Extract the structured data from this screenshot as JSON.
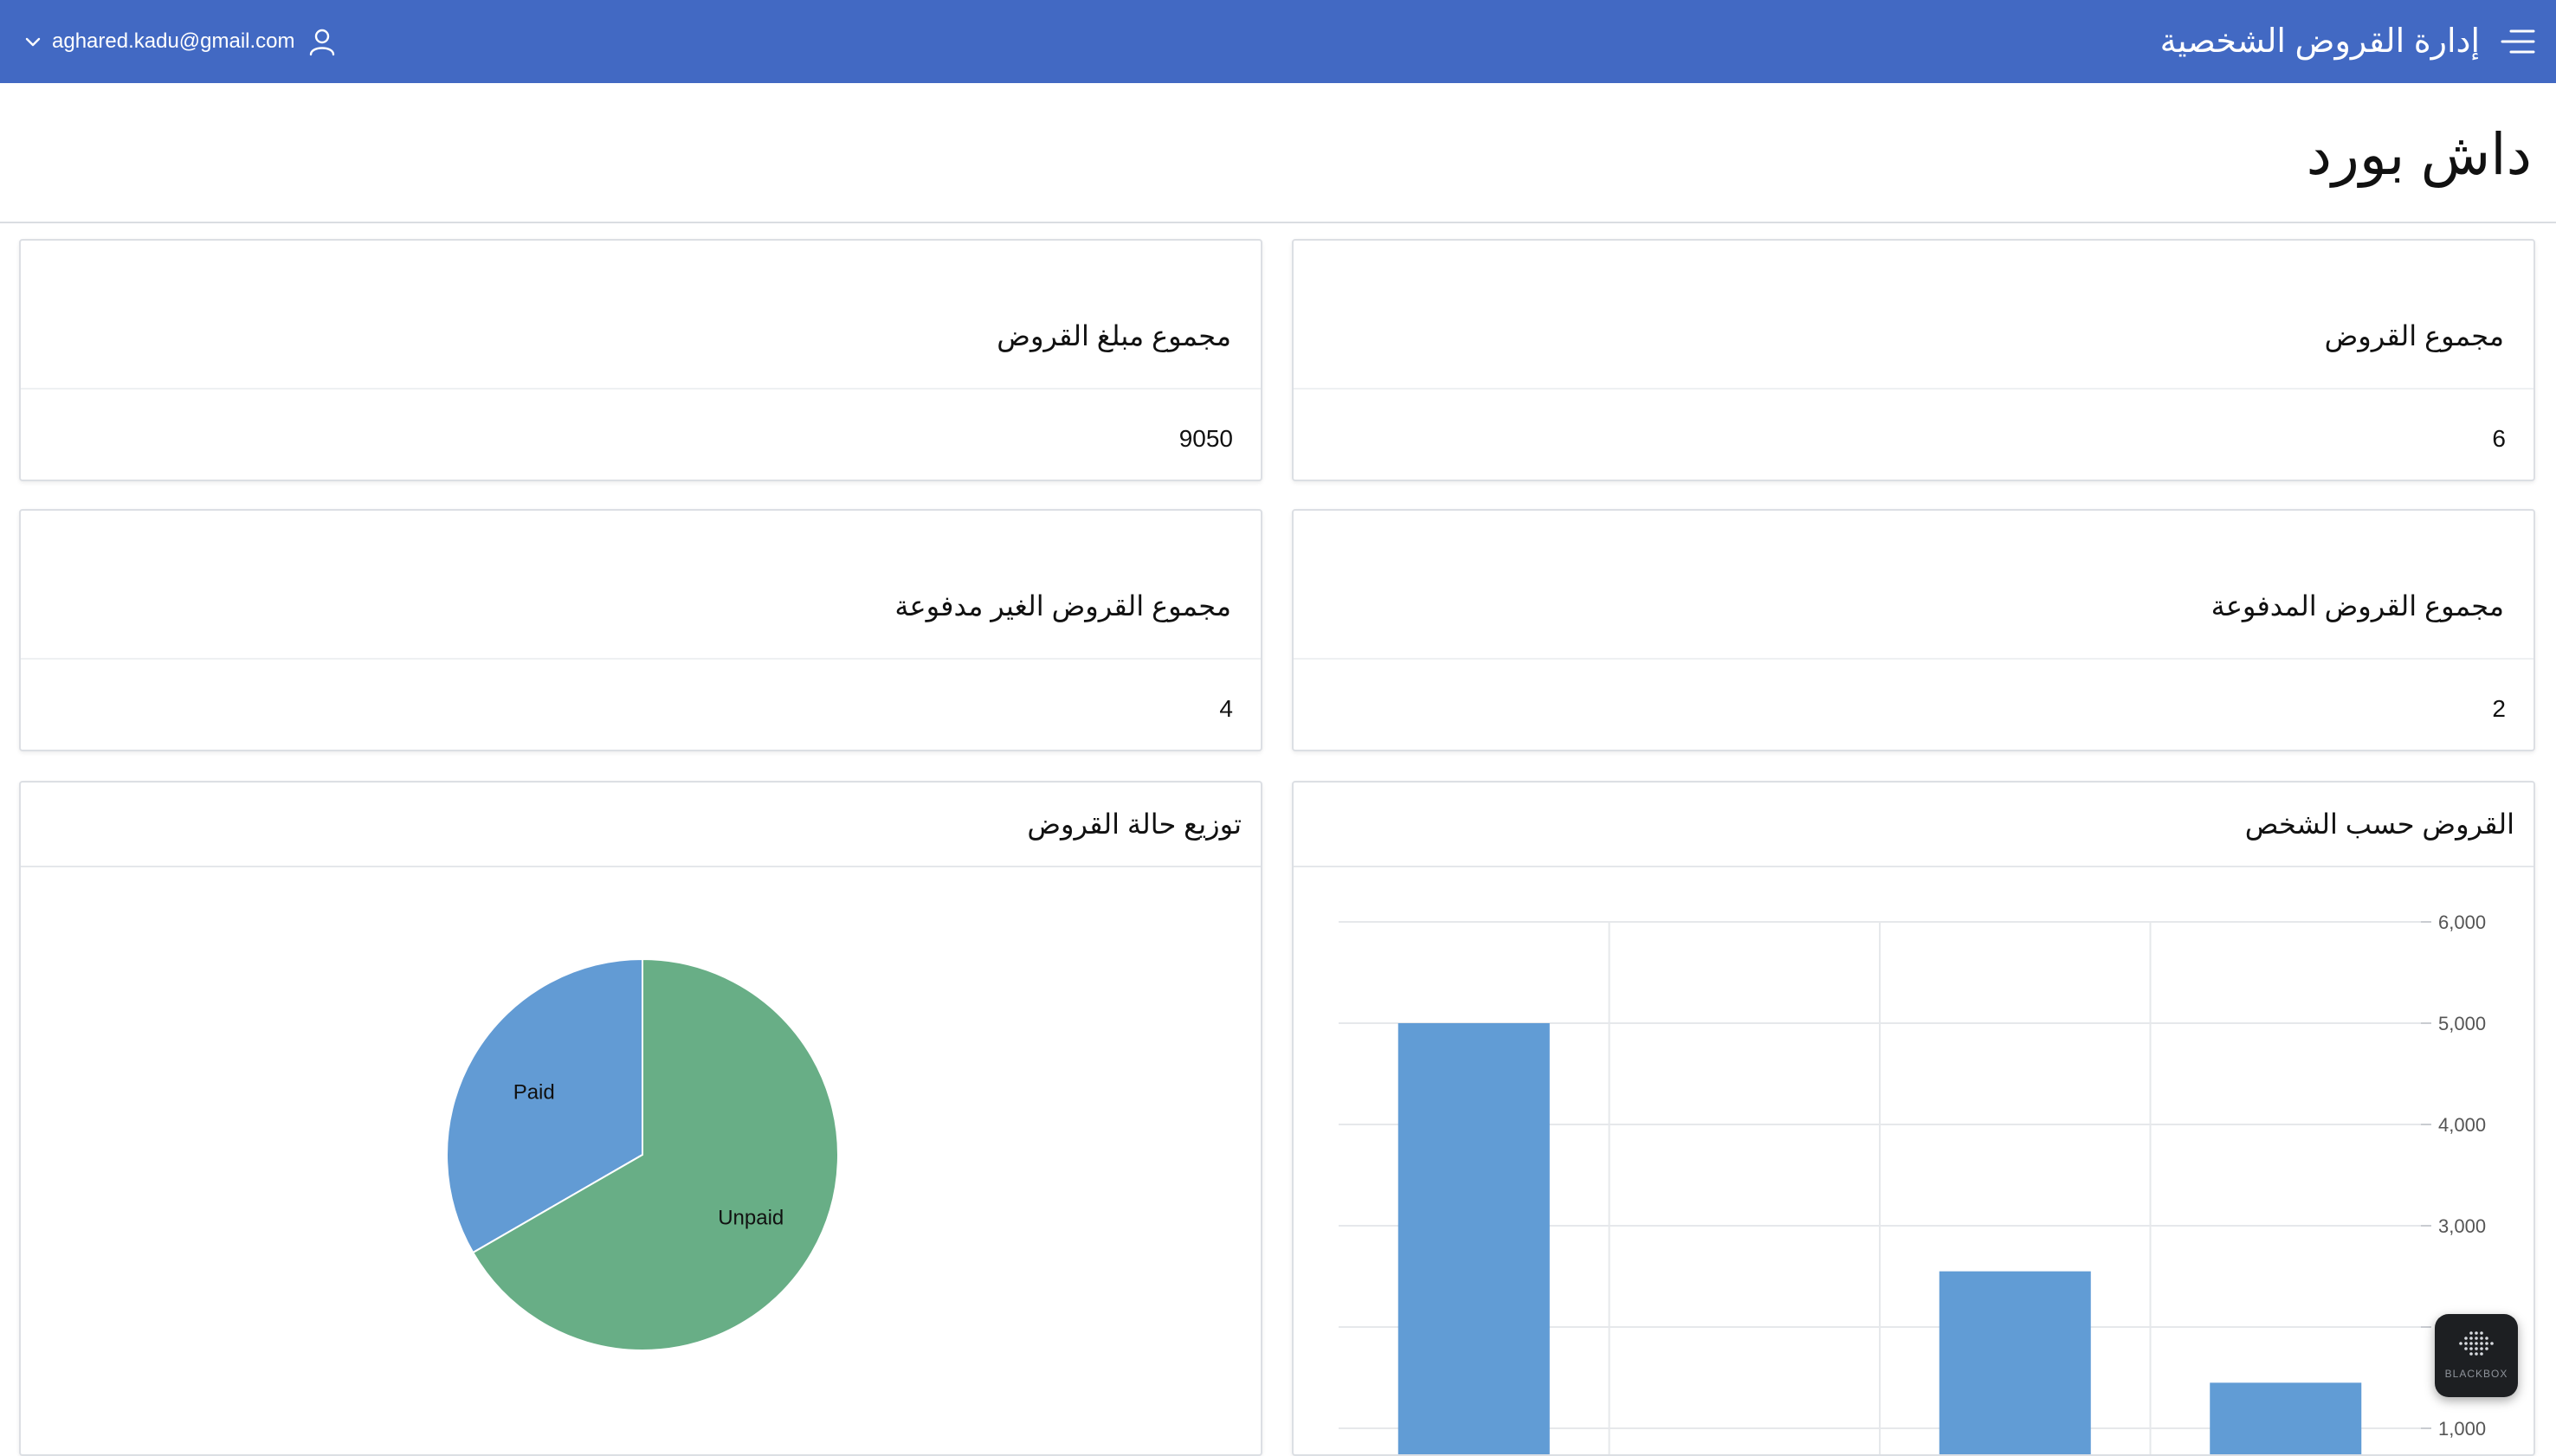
{
  "colors": {
    "topbar": "#4269c3",
    "bar": "#619cd5",
    "pie_paid": "#629bd4",
    "pie_unpaid": "#68ae86"
  },
  "topbar": {
    "app_title": "إدارة القروض الشخصية",
    "user_email": "aghared.kadu@gmail.com",
    "menu_icon": "hamburger-menu-icon",
    "user_icon": "user-icon",
    "dropdown_icon": "chevron-down-icon"
  },
  "page": {
    "title": "داش بورد"
  },
  "cards": {
    "total_loans": {
      "title": "مجموع القروض",
      "value": "6"
    },
    "total_amount": {
      "title": "مجموع مبلغ القروض",
      "value": "9050"
    },
    "paid_loans": {
      "title": "مجموع القروض المدفوعة",
      "value": "2"
    },
    "unpaid_loans": {
      "title": "مجموع القروض الغير مدفوعة",
      "value": "4"
    }
  },
  "charts": {
    "bar_title": "القروض حسب الشخص",
    "pie_title": "توزيع حالة القروض"
  },
  "chart_data": [
    {
      "type": "bar",
      "title": "القروض حسب الشخص",
      "categories": [
        "",
        "",
        "",
        ""
      ],
      "values": [
        5000,
        50,
        2550,
        1450
      ],
      "ylim": [
        0,
        6000
      ],
      "yticks": [
        "1,000",
        "2,000",
        "3,000",
        "4,000",
        "5,000",
        "6,000"
      ],
      "y_axis_side": "right",
      "grid": true
    },
    {
      "type": "pie",
      "title": "توزيع حالة القروض",
      "labels": [
        "Paid",
        "Unpaid"
      ],
      "values": [
        2,
        4
      ]
    }
  ],
  "floating": {
    "blackbox_label": "BLACKBOX",
    "blackbox_icon": "blackbox-logo-icon"
  }
}
